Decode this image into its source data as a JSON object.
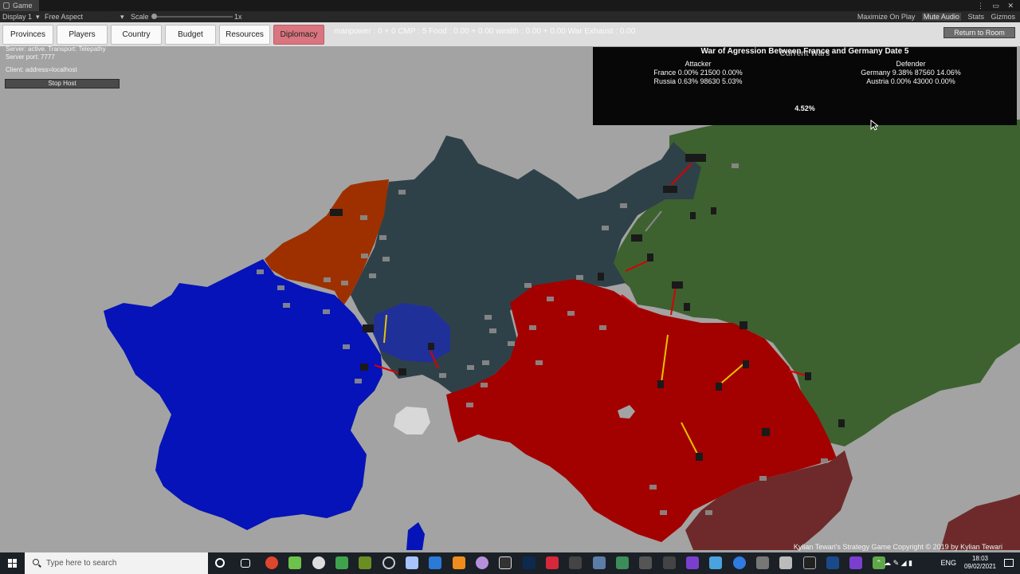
{
  "unity": {
    "tab_label": "Game",
    "window_controls": "⋮ ▭ ✕",
    "display": "Display 1",
    "aspect": "Free Aspect",
    "scale_label": "Scale",
    "scale_value": "1x",
    "toolbar_right": [
      "Maximize On Play",
      "Mute Audio",
      "Stats",
      "Gizmos"
    ]
  },
  "game": {
    "buttons": [
      "Provinces",
      "Players",
      "Country",
      "Budget",
      "Resources",
      "Diplomacy"
    ],
    "active_button": "Diplomacy",
    "stats_line": "manpower : 0 + 0 CMP : 5 Food : 0.00 + 0.00 wealth : 0.00 + 0.00 War Exhaust : 0.00",
    "return_button": "Return to Room",
    "server_status": "Server: active. Transport: Telepathy",
    "server_port": "Server port: 7777",
    "client": "Client: address=localhost",
    "stop_host": "Stop Host",
    "war_panel": {
      "current_wars": "Current Wars",
      "title": "War of Agression Between France and Germany Date 5",
      "attacker_header": "Attacker",
      "defender_header": "Defender",
      "attackers": [
        "France 0.00% 21500 0.00%",
        "Russia 0.63% 98630 5.03%"
      ],
      "defenders": [
        "Germany 9.38% 87560 14.06%",
        "Austria 0.00% 43000 0.00%"
      ],
      "war_score": "4.52%"
    },
    "copyright": "Kylian Tewari's Strategy Game Copyright © 2019 by Kylian Tewari",
    "colors": {
      "france": "#0513b8",
      "belgium": "#9e3000",
      "germany": "#2f4148",
      "austria": "#a30000",
      "russia": "#3d6230",
      "neutral": "#a3a3a3",
      "balkan": "#6e2a2a",
      "ui_bar": "#dedede",
      "diplomacy_active": "#d9757f"
    }
  },
  "taskbar": {
    "search_placeholder": "Type here to search",
    "language": "ENG",
    "time": "18:03",
    "date": "09/02/2021"
  }
}
